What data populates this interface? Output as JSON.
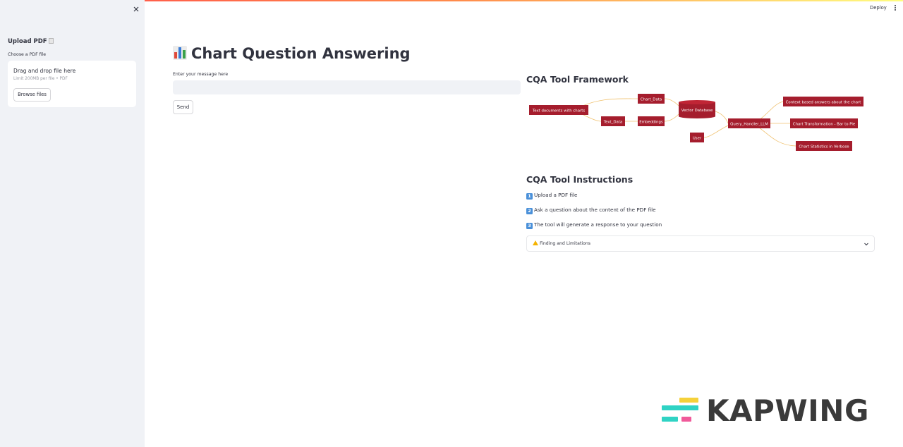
{
  "sidebar": {
    "title": "Upload PDF",
    "title_icon": "page-icon",
    "uploader_label": "Choose a PDF file",
    "drop_text": "Drag and drop file here",
    "limit_text": "Limit 200MB per file • PDF",
    "browse_label": "Browse files",
    "close_icon": "close-icon"
  },
  "header": {
    "deploy_label": "Deploy",
    "menu_icon": "kebab-menu-icon"
  },
  "main": {
    "title": "Chart Question Answering",
    "title_icon": "bar-chart-icon",
    "input_label": "Enter your message here",
    "input_value": "",
    "send_label": "Send"
  },
  "framework": {
    "title": "CQA Tool Framework",
    "nodes": {
      "text_docs": "Text documents with charts",
      "chart_data": "Chart_Data",
      "text_data": "Text_Data",
      "embeddings": "Embeddings",
      "vector_db": "Vector Database",
      "user": "User",
      "query_handler": "Query_Handler_LLM",
      "context_answers": "Context based answers about the chart",
      "chart_transform": "Chart Transformation - Bar to Pie",
      "chart_stats": "Chart Statistics in Verbose"
    },
    "colors": {
      "node": "#a51d2d",
      "edge": "#f0c270"
    }
  },
  "instructions": {
    "title": "CQA Tool Instructions",
    "steps": [
      {
        "num": "1",
        "text": "Upload a PDF file"
      },
      {
        "num": "2",
        "text": "Ask a question about the content of the PDF file"
      },
      {
        "num": "3",
        "text": "The tool will generate a response to your question"
      }
    ],
    "expander_label": "Finding and Limitations",
    "expander_icon": "warning-icon"
  },
  "watermark": {
    "text": "KAPWING",
    "colors": [
      "#f5d13a",
      "#2fd3c4",
      "#f05a9a"
    ]
  }
}
